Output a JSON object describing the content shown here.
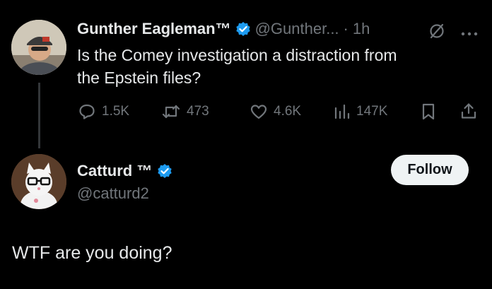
{
  "tweet": {
    "author_name": "Gunther Eagleman™",
    "handle": "@Gunther...",
    "separator": "·",
    "time": "1h",
    "text_line1": "Is the Comey investigation a distraction from",
    "text_line2": "the Epstein files?",
    "metrics": {
      "replies": "1.5K",
      "retweets": "473",
      "likes": "4.6K",
      "views": "147K"
    }
  },
  "reply": {
    "author_name": "Catturd ™",
    "handle": "@catturd2",
    "follow_label": "Follow",
    "text": "WTF are you doing?"
  },
  "colors": {
    "background": "#000000",
    "text": "#e7e9ea",
    "muted": "#71767b",
    "verified": "#1d9bf0",
    "follow_bg": "#eff3f4"
  },
  "icons": [
    "verified-badge-icon",
    "grok-icon",
    "more-icon",
    "reply-icon",
    "retweet-icon",
    "like-icon",
    "views-icon",
    "bookmark-icon",
    "share-icon"
  ]
}
